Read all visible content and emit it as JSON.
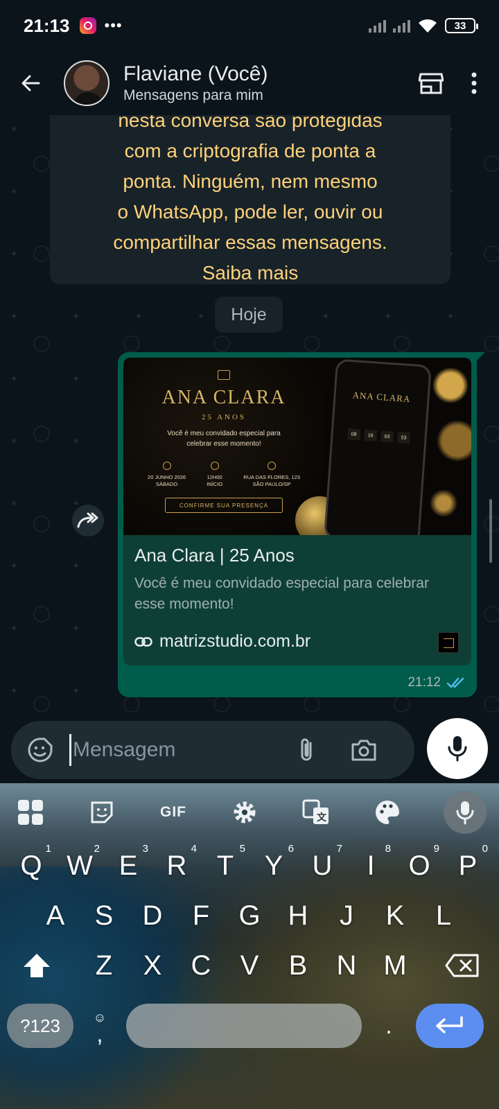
{
  "status_bar": {
    "time": "21:13",
    "dots": "•••",
    "battery": "33"
  },
  "header": {
    "name": "Flaviane (Você)",
    "subtitle": "Mensagens para mim"
  },
  "encryption_notice": {
    "lines": [
      "nesta conversa são protegidas",
      "com a criptografia de ponta a",
      "ponta. Ninguém, nem mesmo",
      "o WhatsApp, pode ler, ouvir ou",
      "compartilhar essas mensagens."
    ],
    "link": "Saiba mais"
  },
  "date_chip": "Hoje",
  "message": {
    "preview_image": {
      "title": "ANA CLARA",
      "age": "25 ANOS",
      "invite_line1": "Você é meu convidado especial para",
      "invite_line2": "celebrar esse momento!",
      "date": "20 JUNHO 2026",
      "weekday": "SÁBADO",
      "hour": "12H00",
      "hour_label": "INÍCIO",
      "address": "RUA DAS FLORES, 123",
      "city": "SÃO PAULO/SP",
      "button": "CONFIRME SUA PRESENÇA",
      "countdown": [
        "08",
        "16",
        "03",
        "53"
      ]
    },
    "link_title": "Ana Clara | 25 Anos",
    "link_description": "Você é meu convidado especial para celebrar esse momento!",
    "link_domain": "matrizstudio.com.br",
    "time": "21:12",
    "status": "read",
    "tick_color": "#53bdeb"
  },
  "composer": {
    "placeholder": "Mensagem"
  },
  "keyboard": {
    "toolbar_gif": "GIF",
    "row1": [
      {
        "k": "Q",
        "n": "1"
      },
      {
        "k": "W",
        "n": "2"
      },
      {
        "k": "E",
        "n": "3"
      },
      {
        "k": "R",
        "n": "4"
      },
      {
        "k": "T",
        "n": "5"
      },
      {
        "k": "Y",
        "n": "6"
      },
      {
        "k": "U",
        "n": "7"
      },
      {
        "k": "I",
        "n": "8"
      },
      {
        "k": "O",
        "n": "9"
      },
      {
        "k": "P",
        "n": "0"
      }
    ],
    "row2": [
      "A",
      "S",
      "D",
      "F",
      "G",
      "H",
      "J",
      "K",
      "L"
    ],
    "row3": [
      "Z",
      "X",
      "C",
      "V",
      "B",
      "N",
      "M"
    ],
    "symbols_key": "?123",
    "comma_key": ",",
    "period_key": "."
  },
  "colors": {
    "bubble": "#005c4b",
    "accent_yellow": "#ffd279",
    "enter_key": "#5b8ef0"
  }
}
